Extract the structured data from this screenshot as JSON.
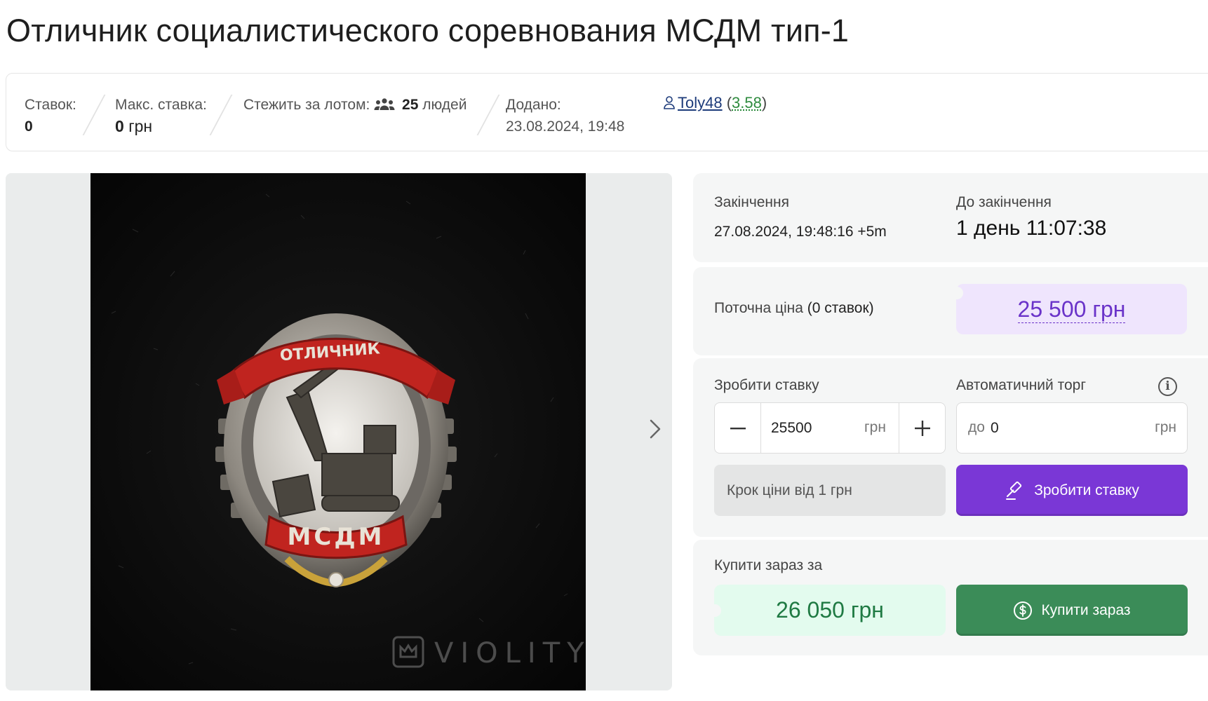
{
  "lot": {
    "title": "Отличник социалистического соревнования МСДМ тип-1"
  },
  "stats": {
    "bids_label": "Ставок:",
    "bids_value": "0",
    "max_bid_label": "Макс. ставка:",
    "max_bid_value": "0",
    "max_bid_currency": "грн",
    "watchers_label": "Стежить за лотом:",
    "watchers_count": "25",
    "watchers_unit": "людей",
    "added_label": "Додано:",
    "added_value": "23.08.2024, 19:48"
  },
  "seller": {
    "name": "Toly48",
    "rating": "3.58"
  },
  "gallery": {
    "watermark": "VIOLITY"
  },
  "auction": {
    "end_label": "Закінчення",
    "end_value": "27.08.2024, 19:48:16 +5m",
    "remaining_label": "До закінчення",
    "remaining_value": "1 день 11:07:38",
    "current_price_label": "Поточна ціна",
    "current_price_bids": "(0 ставок)",
    "current_price": "25 500 грн"
  },
  "bid": {
    "label": "Зробити ставку",
    "amount": "25500",
    "currency": "грн",
    "auto_label": "Автоматичний торг",
    "auto_prefix": "до",
    "auto_value": "0",
    "auto_currency": "грн",
    "step_note": "Крок ціни від 1 грн",
    "submit_label": "Зробити ставку"
  },
  "buy_now": {
    "label": "Купити зараз за",
    "price": "26 050 грн",
    "button_label": "Купити зараз"
  },
  "colors": {
    "accent_purple": "#7a37d6",
    "buy_green": "#3b8c58",
    "price_tag_bg": "#efe5fd",
    "buy_price_bg": "#e3fbee"
  },
  "icons": [
    "users-icon",
    "user-icon",
    "chevron-right-icon",
    "info-icon",
    "gavel-icon",
    "dollar-circle-icon",
    "violity-crown-icon"
  ]
}
